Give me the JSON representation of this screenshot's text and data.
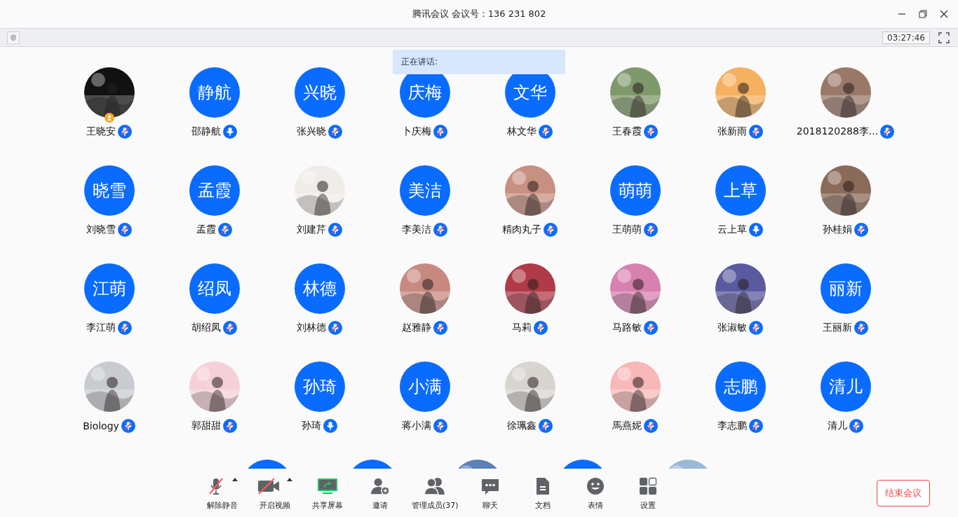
{
  "window": {
    "title": "腾讯会议 会议号：136 231 802"
  },
  "status_bar": {
    "timer": "03:27:46"
  },
  "speaking": {
    "label": "正在讲话:"
  },
  "participants": [
    {
      "name": "王晓安",
      "kind": "picture",
      "muted": true,
      "host": true
    },
    {
      "name": "邵静航",
      "kind": "initials",
      "initials": "静航",
      "muted": false
    },
    {
      "name": "张兴晓",
      "kind": "initials",
      "initials": "兴晓",
      "muted": true
    },
    {
      "name": "卜庆梅",
      "kind": "initials",
      "initials": "庆梅",
      "muted": true
    },
    {
      "name": "林文华",
      "kind": "initials",
      "initials": "文华",
      "muted": true
    },
    {
      "name": "王春霞",
      "kind": "picture",
      "muted": true
    },
    {
      "name": "张新雨",
      "kind": "picture",
      "muted": true
    },
    {
      "name": "2018120288李...",
      "kind": "picture",
      "muted": true
    },
    {
      "name": "刘晓雪",
      "kind": "initials",
      "initials": "晓雪",
      "muted": true
    },
    {
      "name": "孟霞",
      "kind": "initials",
      "initials": "孟霞",
      "muted": true
    },
    {
      "name": "刘建芹",
      "kind": "picture",
      "muted": true
    },
    {
      "name": "李美洁",
      "kind": "initials",
      "initials": "美洁",
      "muted": true
    },
    {
      "name": "精肉丸子",
      "kind": "picture",
      "muted": true
    },
    {
      "name": "王萌萌",
      "kind": "initials",
      "initials": "萌萌",
      "muted": true
    },
    {
      "name": "云上草",
      "kind": "initials",
      "initials": "上草",
      "muted": false
    },
    {
      "name": "孙桂娟",
      "kind": "picture",
      "muted": true
    },
    {
      "name": "李江萌",
      "kind": "initials",
      "initials": "江萌",
      "muted": true
    },
    {
      "name": "胡绍凤",
      "kind": "initials",
      "initials": "绍凤",
      "muted": true
    },
    {
      "name": "刘林德",
      "kind": "initials",
      "initials": "林德",
      "muted": true
    },
    {
      "name": "赵雅静",
      "kind": "picture",
      "muted": true
    },
    {
      "name": "马莉",
      "kind": "picture",
      "muted": true
    },
    {
      "name": "马路敏",
      "kind": "picture",
      "muted": true
    },
    {
      "name": "张淑敏",
      "kind": "picture",
      "muted": true
    },
    {
      "name": "王丽新",
      "kind": "initials",
      "initials": "丽新",
      "muted": true
    },
    {
      "name": "Biology",
      "kind": "picture",
      "muted": true
    },
    {
      "name": "郭甜甜",
      "kind": "picture",
      "muted": true
    },
    {
      "name": "孙琦",
      "kind": "initials",
      "initials": "孙琦",
      "muted": false
    },
    {
      "name": "蒋小满",
      "kind": "initials",
      "initials": "小满",
      "muted": true
    },
    {
      "name": "徐珮鑫",
      "kind": "picture",
      "muted": true
    },
    {
      "name": "馬燕妮",
      "kind": "picture",
      "muted": true
    },
    {
      "name": "李志鹏",
      "kind": "initials",
      "initials": "志鹏",
      "muted": true
    },
    {
      "name": "清儿",
      "kind": "initials",
      "initials": "清儿",
      "muted": true
    },
    {
      "kind": "initials"
    },
    {
      "kind": "initials"
    },
    {
      "kind": "picture"
    },
    {
      "kind": "initials"
    },
    {
      "kind": "picture"
    }
  ],
  "toolbar": [
    {
      "label": "解除静音",
      "kind": "mic-off",
      "menu": true
    },
    {
      "label": "开启视频",
      "kind": "camera-off",
      "menu": true
    },
    {
      "label": "共享屏幕",
      "kind": "share"
    },
    {
      "label": "邀请",
      "kind": "invite"
    },
    {
      "label": "管理成员(37)",
      "kind": "members"
    },
    {
      "label": "聊天",
      "kind": "chat"
    },
    {
      "label": "文档",
      "kind": "document"
    },
    {
      "label": "表情",
      "kind": "emoji"
    },
    {
      "label": "设置",
      "kind": "settings"
    }
  ],
  "end_button": {
    "label": "结束会议"
  }
}
